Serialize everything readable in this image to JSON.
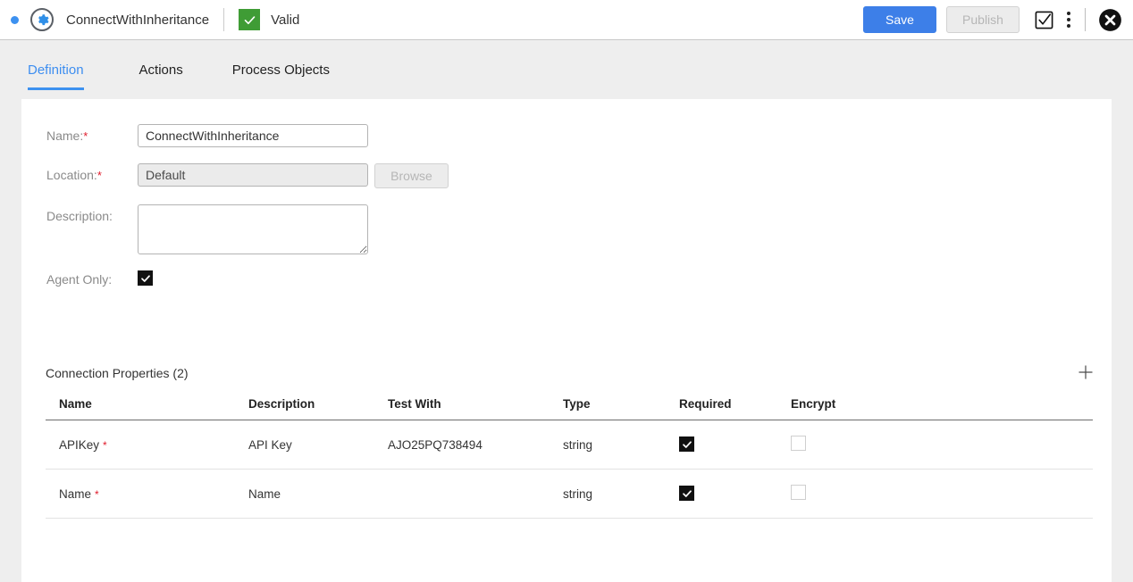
{
  "header": {
    "status_dot": "status-dot",
    "icon": "gear-icon",
    "title": "ConnectWithInheritance",
    "validity_badge": "check-icon",
    "validity_label": "Valid",
    "save_label": "Save",
    "publish_label": "Publish",
    "validate_icon": "checkbox-check-icon",
    "menu_icon": "more-vertical-icon",
    "close_icon": "close-circle-icon",
    "colors": {
      "save_bg": "#3d7fe8",
      "publish_bg": "#ececec",
      "valid_green": "#3f9c35",
      "accent_blue": "#3d91f0"
    }
  },
  "tabs": [
    {
      "label": "Definition",
      "active": true
    },
    {
      "label": "Actions",
      "active": false
    },
    {
      "label": "Process Objects",
      "active": false
    }
  ],
  "form": {
    "name": {
      "label": "Name:",
      "required_marker": "*",
      "value": "ConnectWithInheritance",
      "placeholder": ""
    },
    "location": {
      "label": "Location:",
      "required_marker": "*",
      "value": "Default",
      "placeholder": "",
      "browse_label": "Browse",
      "disabled": true
    },
    "description": {
      "label": "Description:",
      "value": "",
      "placeholder": ""
    },
    "agent_only": {
      "label": "Agent Only:",
      "checked": true
    }
  },
  "connection_properties": {
    "title": "Connection Properties (2)",
    "add_icon": "plus-icon",
    "columns": [
      "Name",
      "Description",
      "Test With",
      "Type",
      "Required",
      "Encrypt"
    ],
    "rows": [
      {
        "name": "APIKey",
        "name_required_marker": "*",
        "description": "API Key",
        "test_with": "AJO25PQ738494",
        "type": "string",
        "required": true,
        "encrypt": false
      },
      {
        "name": "Name",
        "name_required_marker": "*",
        "description": "Name",
        "test_with": "",
        "type": "string",
        "required": true,
        "encrypt": false
      }
    ]
  }
}
